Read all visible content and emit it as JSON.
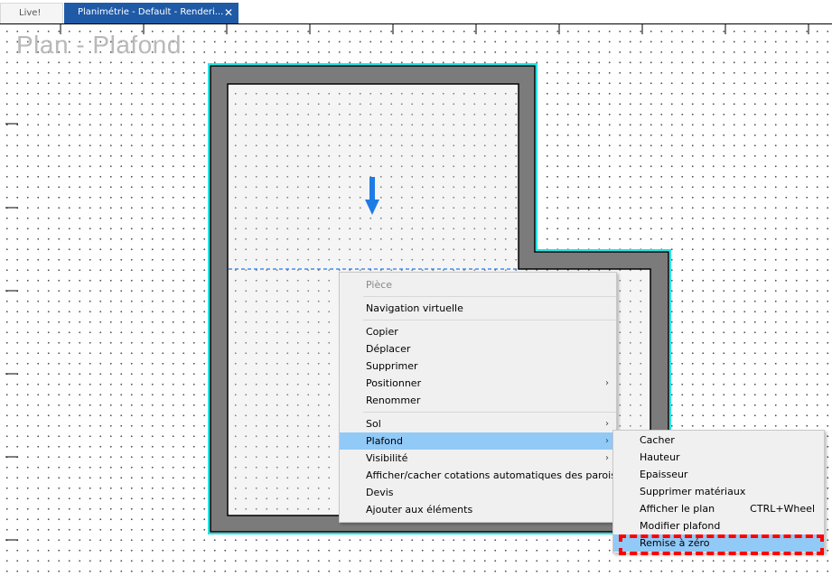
{
  "tabs": [
    {
      "label": "Live!"
    },
    {
      "label": "Planimétrie - Default - Renderi..."
    }
  ],
  "plan": {
    "title": "Plan - Plafond"
  },
  "context_menu": {
    "header": "Pièce",
    "items": [
      "Navigation virtuelle",
      "Copier",
      "Déplacer",
      "Supprimer",
      "Positionner",
      "Renommer",
      "Sol",
      "Plafond",
      "Visibilité",
      "Afficher/cacher cotations automatiques des parois",
      "Devis",
      "Ajouter aux éléments"
    ]
  },
  "submenu": {
    "items": [
      "Cacher",
      "Hauteur",
      "Epaisseur",
      "Supprimer matériaux",
      "Afficher le plan",
      "Modifier plafond",
      "Remise à zéro"
    ],
    "shortcut_afficher_le_plan": "CTRL+Wheel"
  },
  "colors": {
    "tab_active": "#1f5aa7",
    "wall": "#7b7b7b",
    "selection_outline": "#22e5e5",
    "arrow": "#1e7be6",
    "menu_highlight": "#91c9f7",
    "annotation": "#ff0000"
  }
}
